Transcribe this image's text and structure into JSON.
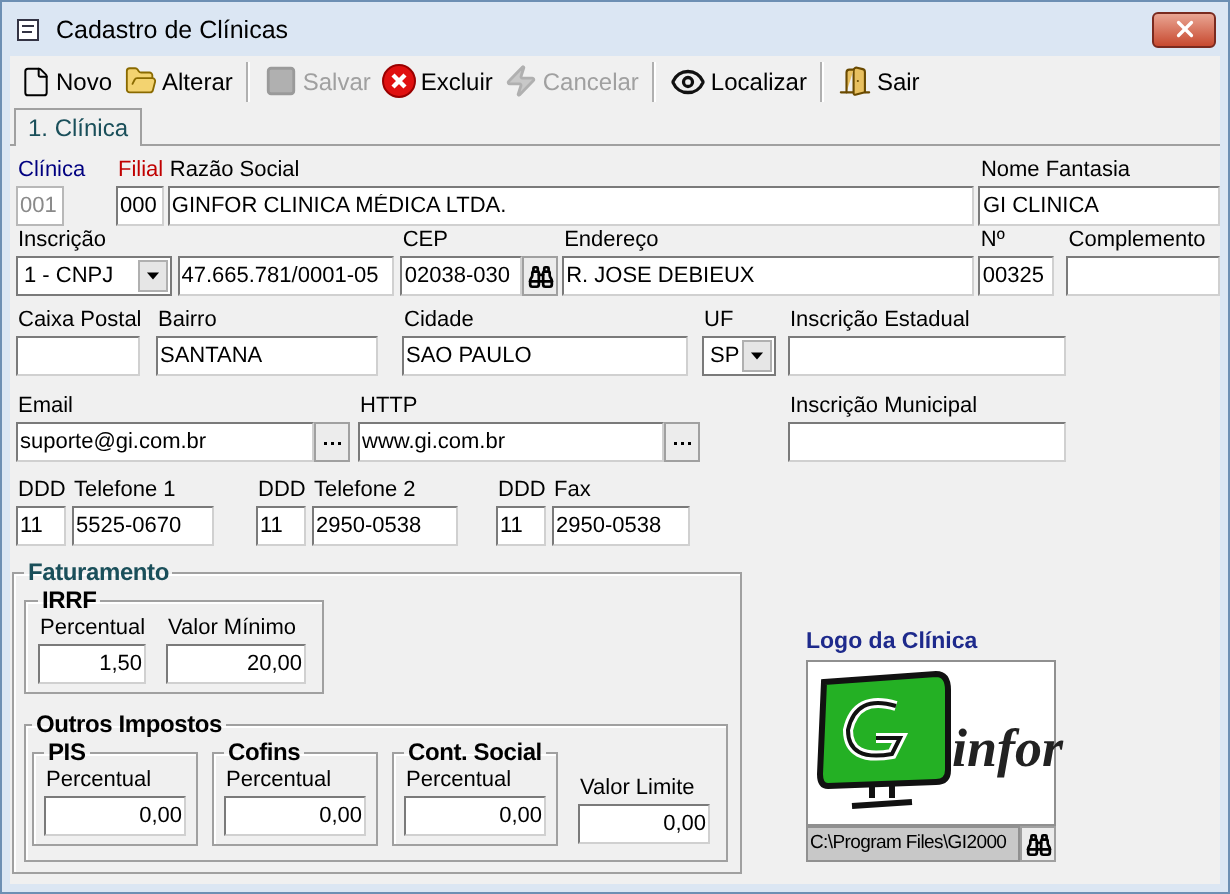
{
  "window": {
    "title": "Cadastro de Clínicas"
  },
  "toolbar": [
    [
      {
        "kind": "new",
        "label": "Novo",
        "disabled": false
      },
      {
        "kind": "edit",
        "label": "Alterar",
        "disabled": false
      }
    ],
    [
      {
        "kind": "save",
        "label": "Salvar",
        "disabled": true
      },
      {
        "kind": "delete",
        "label": "Excluir",
        "disabled": false
      },
      {
        "kind": "cancel",
        "label": "Cancelar",
        "disabled": true
      }
    ],
    [
      {
        "kind": "find",
        "label": "Localizar",
        "disabled": false
      }
    ],
    [
      {
        "kind": "exit",
        "label": "Sair",
        "disabled": false
      }
    ]
  ],
  "tabs": [
    {
      "label": "1. Clínica",
      "selected": true
    }
  ],
  "rows": [
    [
      {
        "kind": "text",
        "label": "Clínica",
        "color": "#000080",
        "value": "001",
        "disabled": true
      },
      {
        "kind": "text",
        "label": "Filial",
        "color": "#c00000",
        "value": "000",
        "disabled": false
      },
      {
        "kind": "text",
        "label": "Razão Social",
        "value": "GINFOR CLINICA MÉDICA LTDA.",
        "disabled": false
      },
      {
        "kind": "text",
        "label": "Nome Fantasia",
        "value": "GI CLINICA",
        "disabled": false
      }
    ],
    [
      {
        "kind": "select",
        "label": "Inscrição",
        "value": "1 - CNPJ",
        "disabled": false
      },
      {
        "kind": "text",
        "value": "47.665.781/0001-05",
        "disabled": false
      },
      {
        "kind": "lookup",
        "label": "CEP",
        "value": "02038-030",
        "disabled": false
      },
      {
        "kind": "text",
        "label": "Endereço",
        "value": "R. JOSE DEBIEUX",
        "disabled": false
      },
      {
        "kind": "text",
        "label": "Nº",
        "value": "00325",
        "disabled": false
      },
      {
        "kind": "text",
        "label": "Complemento",
        "disabled": false
      }
    ],
    [
      {
        "kind": "text",
        "label": "Caixa Postal",
        "disabled": false
      },
      {
        "kind": "text",
        "label": "Bairro",
        "value": "SANTANA",
        "disabled": false
      },
      {
        "kind": "text",
        "label": "Cidade",
        "value": "SAO PAULO",
        "disabled": false
      },
      {
        "kind": "select",
        "label": "UF",
        "value": "SP",
        "disabled": false
      },
      {
        "kind": "text",
        "label": "Inscrição Estadual",
        "disabled": false
      }
    ],
    [
      {
        "kind": "ellipsis",
        "label": "Email",
        "value": "suporte@gi.com.br",
        "disabled": false
      },
      {
        "kind": "ellipsis",
        "label": "HTTP",
        "value": "www.gi.com.br",
        "disabled": false
      },
      {
        "kind": "text",
        "label": "Inscrição Municipal",
        "disabled": false
      }
    ],
    [
      {
        "kind": "text",
        "label": "DDD",
        "value": "11",
        "disabled": false
      },
      {
        "kind": "text",
        "label": "Telefone 1",
        "value": "5525-0670",
        "disabled": false
      },
      {
        "kind": "text",
        "label": "DDD",
        "value": "11",
        "disabled": false
      },
      {
        "kind": "text",
        "label": "Telefone 2",
        "value": "2950-0538",
        "disabled": false
      },
      {
        "kind": "text",
        "label": "DDD",
        "value": "11",
        "disabled": false
      },
      {
        "kind": "text",
        "label": "Fax",
        "value": "2950-0538",
        "disabled": false
      }
    ]
  ],
  "billing": {
    "title": "Faturamento",
    "irrf": {
      "title": "IRRF",
      "fields": [
        {
          "label": "Percentual",
          "value": "1,50"
        },
        {
          "label": "Valor Mínimo",
          "value": "20,00"
        }
      ]
    },
    "other": {
      "title": "Outros Impostos",
      "groups": [
        {
          "title": "PIS",
          "label": "Percentual",
          "value": "0,00"
        },
        {
          "title": "Cofins",
          "label": "Percentual",
          "value": "0,00"
        },
        {
          "title": "Cont. Social",
          "label": "Percentual",
          "value": "0,00"
        }
      ],
      "limit": {
        "label": "Valor Limite",
        "value": "0,00"
      }
    }
  },
  "logo": {
    "title": "Logo da Clínica",
    "brand": "infor",
    "path": "C:\\Program Files\\GI2000"
  }
}
